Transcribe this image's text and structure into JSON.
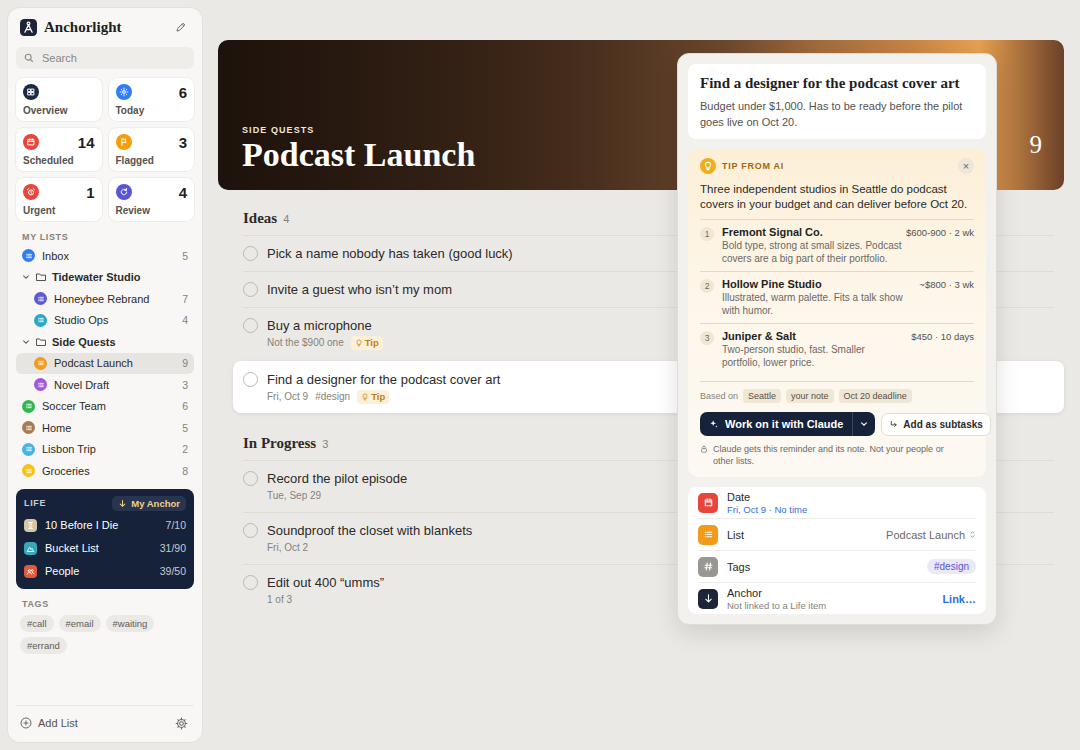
{
  "app": {
    "name": "Anchorlight"
  },
  "sidebar": {
    "search": {
      "placeholder": "Search"
    },
    "smart_lists": [
      {
        "name": "Overview",
        "count": "",
        "color": "#1d2a44"
      },
      {
        "name": "Today",
        "count": "6",
        "color": "#2f7cf6"
      },
      {
        "name": "Scheduled",
        "count": "14",
        "color": "#e8453c"
      },
      {
        "name": "Flagged",
        "count": "3",
        "color": "#f59e0b"
      },
      {
        "name": "Urgent",
        "count": "1",
        "color": "#e8453c"
      },
      {
        "name": "Review",
        "count": "4",
        "color": "#5856d6"
      }
    ],
    "my_lists_label": "MY LISTS",
    "lists": [
      {
        "kind": "list",
        "name": "Inbox",
        "count": "5",
        "color": "#2f7cf6",
        "selected": false
      },
      {
        "kind": "folder",
        "name": "Tidewater Studio",
        "expanded": true,
        "selected": false,
        "children": [
          {
            "kind": "list",
            "name": "Honeybee Rebrand",
            "count": "7",
            "color": "#5b5bd6",
            "selected": false
          },
          {
            "kind": "list",
            "name": "Studio Ops",
            "count": "4",
            "color": "#2aa7c4",
            "selected": false
          }
        ]
      },
      {
        "kind": "folder",
        "name": "Side Quests",
        "expanded": true,
        "selected": false,
        "children": [
          {
            "kind": "list",
            "name": "Podcast Launch",
            "count": "9",
            "color": "#f29a1a",
            "selected": true
          },
          {
            "kind": "list",
            "name": "Novel Draft",
            "count": "3",
            "color": "#a259d9",
            "selected": false
          }
        ]
      },
      {
        "kind": "list",
        "name": "Soccer Team",
        "count": "6",
        "color": "#34b554",
        "selected": false
      },
      {
        "kind": "list",
        "name": "Home",
        "count": "5",
        "color": "#a57b52",
        "selected": false
      },
      {
        "kind": "list",
        "name": "Lisbon Trip",
        "count": "2",
        "color": "#45b3e8",
        "selected": false
      },
      {
        "kind": "list",
        "name": "Groceries",
        "count": "8",
        "color": "#f5c21b",
        "selected": false
      }
    ],
    "life": {
      "label": "LIFE",
      "anchor_button": "My Anchor",
      "items": [
        {
          "name": "10 Before I Die",
          "count": "7/10",
          "color": "#d8c6a2"
        },
        {
          "name": "Bucket List",
          "count": "31/90",
          "color": "#3aa6b9"
        },
        {
          "name": "People",
          "count": "39/50",
          "color": "#e05a3a"
        }
      ]
    },
    "tags_label": "TAGS",
    "tags": [
      "#call",
      "#email",
      "#waiting",
      "#errand"
    ],
    "footer": {
      "add_list": "Add List"
    }
  },
  "hero": {
    "eyebrow": "SIDE QUESTS",
    "title": "Podcast Launch",
    "count": "9"
  },
  "sections": [
    {
      "title": "Ideas",
      "count": "4",
      "tasks": [
        {
          "title": "Pick a name nobody has taken (good luck)",
          "done": false,
          "selected": false,
          "meta": []
        },
        {
          "title": "Invite a guest who isn’t my mom",
          "done": false,
          "selected": false,
          "meta": []
        },
        {
          "title": "Buy a microphone",
          "done": false,
          "selected": false,
          "meta": [
            {
              "kind": "text",
              "text": "Not the $900 one"
            },
            {
              "kind": "tip",
              "text": "Tip"
            }
          ]
        },
        {
          "title": "Find a designer for the podcast cover art",
          "done": false,
          "selected": true,
          "meta": [
            {
              "kind": "text",
              "text": "Fri, Oct 9"
            },
            {
              "kind": "text",
              "text": "#design"
            },
            {
              "kind": "tip",
              "text": "Tip"
            }
          ]
        }
      ]
    },
    {
      "title": "In Progress",
      "count": "3",
      "tasks": [
        {
          "title": "Record the pilot episode",
          "done": false,
          "selected": false,
          "meta": [
            {
              "kind": "text",
              "text": "Tue, Sep 29"
            }
          ]
        },
        {
          "title": "Soundproof the closet with blankets",
          "done": false,
          "selected": false,
          "meta": [
            {
              "kind": "text",
              "text": "Fri, Oct 2"
            }
          ]
        },
        {
          "title": "Edit out 400 “umms”",
          "done": false,
          "selected": false,
          "meta": [
            {
              "kind": "text",
              "text": "1 of 3"
            }
          ]
        }
      ]
    }
  ],
  "detail": {
    "title": "Find a designer for the podcast cover art",
    "note": "Budget under $1,000. Has to be ready before the pilot goes live on Oct 20.",
    "tip": {
      "label": "TIP FROM AI",
      "close": "×",
      "summary": "Three independent studios in Seattle do podcast covers in your budget and can deliver before Oct 20.",
      "options": [
        {
          "number": "1",
          "name": "Fremont Signal Co.",
          "price": "$600-900 · 2 wk",
          "description": "Bold type, strong at small sizes. Podcast covers are a big part of their portfolio."
        },
        {
          "number": "2",
          "name": "Hollow Pine Studio",
          "price": "~$800 · 3 wk",
          "description": "Illustrated, warm palette. Fits a talk show with humor."
        },
        {
          "number": "3",
          "name": "Juniper & Salt",
          "price": "$450 · 10 days",
          "description": "Two-person studio, fast. Smaller portfolio, lower price."
        }
      ],
      "based_on_label": "Based on",
      "based_on": [
        "Seattle",
        "your note",
        "Oct 20 deadline"
      ],
      "primary_action": "Work on it with Claude",
      "secondary_action": "Add as subtasks",
      "privacy": "Claude gets this reminder and its note. Not your people or other lists."
    },
    "fields": [
      {
        "kind": "date",
        "label": "Date",
        "value": "Fri, Oct 9 · No time",
        "color": "#e8453c"
      },
      {
        "kind": "list",
        "label": "List",
        "value": "Podcast Launch",
        "color": "#f29a1a"
      },
      {
        "kind": "tags",
        "label": "Tags",
        "value": "#design",
        "color": "#9a9792"
      },
      {
        "kind": "anchor",
        "label": "Anchor",
        "sub": "Not linked to a Life item",
        "value": "Link…",
        "color": "#1c2638"
      }
    ]
  }
}
